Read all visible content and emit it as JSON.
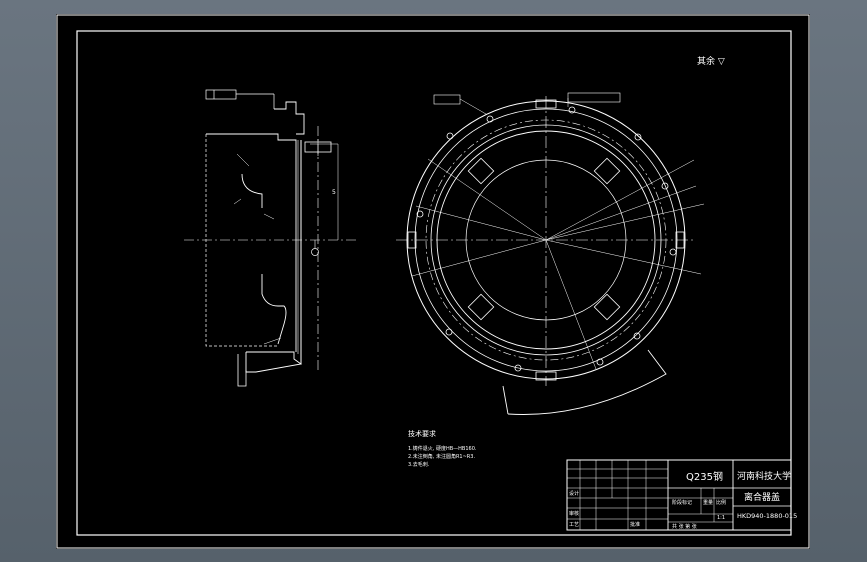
{
  "drawing": {
    "surface_finish": "其余 ▽",
    "material": "Q235钢",
    "university": "河南科技大学",
    "part_name": "离合器盖",
    "drawing_number": "HKD940-1880-015",
    "tech_req_title": "技术要求",
    "tech_req_lines": [
      "1.铸件退火, 硬度HB—HB160.",
      "2.未注倒角, 未注圆角R1~R3.",
      "3.去毛刺."
    ],
    "title_block_labels": {
      "design": "设计",
      "check": "审核",
      "process": "工艺",
      "approve": "批准",
      "stage_mark": "阶段标记",
      "weight": "重量",
      "scale": "比例",
      "scale_value": "1:1",
      "sheet": "共 张 第 张"
    },
    "colors": {
      "background": "#000000",
      "lines": "#ffffff",
      "frame_bg": "#5b6670"
    }
  }
}
